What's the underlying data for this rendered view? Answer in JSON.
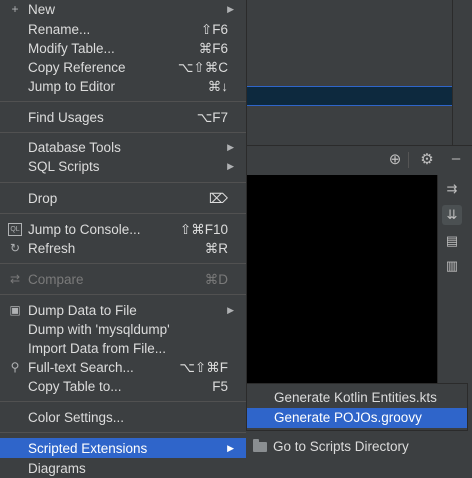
{
  "menu": {
    "items": [
      {
        "label": "New",
        "shortcut": "",
        "arrow": true,
        "icon": "+"
      },
      {
        "label": "Rename...",
        "shortcut": "⇧F6"
      },
      {
        "label": "Modify Table...",
        "shortcut": "⌘F6"
      },
      {
        "label": "Copy Reference",
        "shortcut": "⌥⇧⌘C"
      },
      {
        "label": "Jump to Editor",
        "shortcut": "⌘↓"
      },
      {
        "label": "Find Usages",
        "shortcut": "⌥F7"
      },
      {
        "label": "Database Tools",
        "shortcut": "",
        "arrow": true
      },
      {
        "label": "SQL Scripts",
        "shortcut": "",
        "arrow": true
      },
      {
        "label": "Drop",
        "shortcut": "⌦"
      },
      {
        "label": "Jump to Console...",
        "shortcut": "⇧⌘F10",
        "icon": "QL"
      },
      {
        "label": "Refresh",
        "shortcut": "⌘R",
        "icon": "↻"
      },
      {
        "label": "Compare",
        "shortcut": "⌘D",
        "icon": "⇄",
        "disabled": true
      },
      {
        "label": "Dump Data to File",
        "shortcut": "",
        "arrow": true,
        "icon": "▣"
      },
      {
        "label": "Dump with 'mysqldump'",
        "shortcut": ""
      },
      {
        "label": "Import Data from File...",
        "shortcut": ""
      },
      {
        "label": "Full-text Search...",
        "shortcut": "⌥⇧⌘F",
        "icon": "⚲"
      },
      {
        "label": "Copy Table to...",
        "shortcut": "F5"
      },
      {
        "label": "Color Settings...",
        "shortcut": ""
      },
      {
        "label": "Scripted Extensions",
        "shortcut": "",
        "arrow": true
      },
      {
        "label": "Diagrams",
        "shortcut": ""
      }
    ]
  },
  "submenu": {
    "items": [
      {
        "label": "Generate Kotlin Entities.kts"
      },
      {
        "label": "Generate POJOs.groovy"
      }
    ],
    "bottom_label": "Go to Scripts Directory"
  },
  "icons": {
    "toolbar": [
      "crosshair-icon",
      "gear-icon",
      "minimize-icon"
    ],
    "console": [
      "soft-wrap-icon",
      "scroll-to-end-icon",
      "print-icon",
      "trash-icon"
    ]
  },
  "colors": {
    "selection": "#2f65ca",
    "menu_bg": "#3c3f41",
    "console_bg": "#000000"
  }
}
